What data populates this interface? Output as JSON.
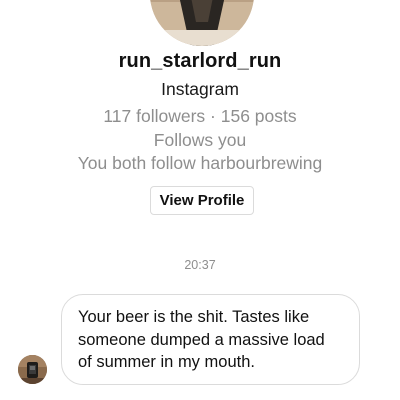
{
  "profile": {
    "username": "run_starlord_run",
    "platform": "Instagram",
    "stats": "117 followers · 156 posts",
    "follows_you": "Follows you",
    "mutual_follow": "You both follow harbourbrewing",
    "view_profile_label": "View Profile",
    "avatar_icon": "profile-photo"
  },
  "conversation": {
    "timestamp": "20:37",
    "messages": [
      {
        "sender_avatar_icon": "profile-photo",
        "text": "Your beer is the shit. Tastes like\nsomeone dumped a massive load\nof summer in my mouth."
      }
    ]
  },
  "colors": {
    "background": "#ffffff",
    "primary_text": "#111111",
    "secondary_text": "#8e8e8e",
    "border": "#dbdbdb"
  }
}
